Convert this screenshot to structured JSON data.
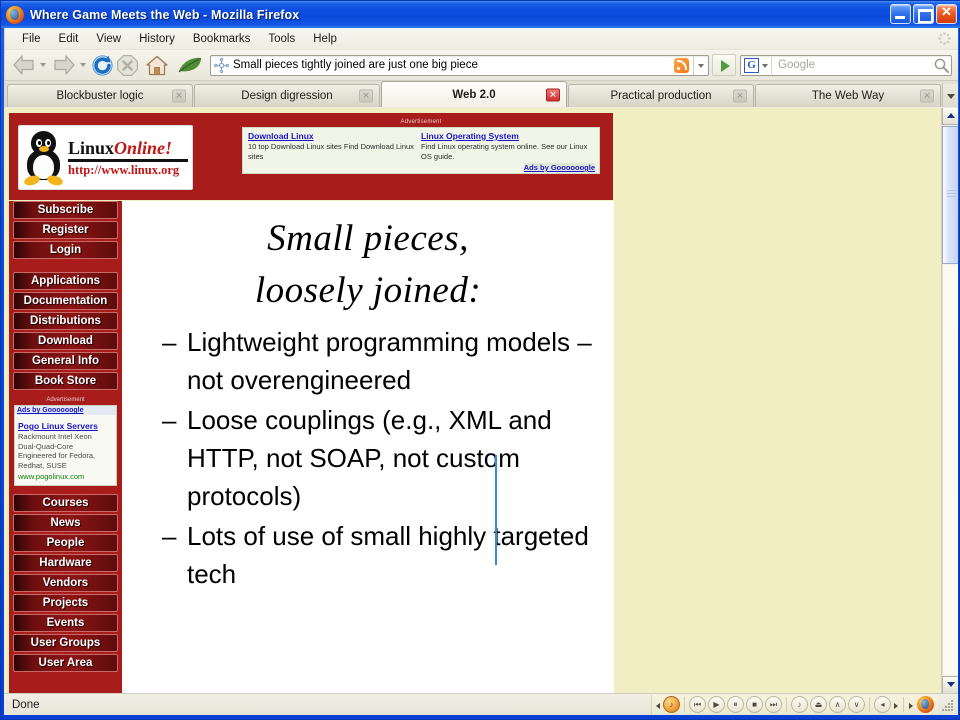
{
  "window": {
    "title": "Where Game Meets the Web - Mozilla Firefox",
    "minimize_label": "Minimize",
    "maximize_label": "Maximize",
    "close_label": "Close"
  },
  "menu": {
    "items": [
      "File",
      "Edit",
      "View",
      "History",
      "Bookmarks",
      "Tools",
      "Help"
    ]
  },
  "toolbar": {
    "back_label": "Back",
    "forward_label": "Forward",
    "reload_label": "Reload",
    "stop_label": "Stop",
    "home_label": "Home",
    "leaf_label": "Feather",
    "url": "Small pieces tightly joined are just one big piece",
    "go_label": "Go",
    "search_engine": "G",
    "search_placeholder": "Google",
    "search_value": ""
  },
  "tabs": [
    {
      "label": "Blockbuster logic",
      "active": false
    },
    {
      "label": "Design digression",
      "active": false
    },
    {
      "label": "Web 2.0",
      "active": true
    },
    {
      "label": "Practical production",
      "active": false
    },
    {
      "label": "The Web Way",
      "active": false
    }
  ],
  "site": {
    "logo": {
      "word_linux": "Linux",
      "word_online": "Online!",
      "url": "http://www.linux.org"
    },
    "banner_color": "#a81c1c",
    "page_background": "#f2eec4",
    "top_ad": {
      "advertisement_label": "Advertisement",
      "columns": [
        {
          "title": "Download Linux",
          "body": "10 top Download Linux sites Find Download Linux sites"
        },
        {
          "title": "Linux Operating System",
          "body": "Find Linux operating system online. See our Linux OS guide."
        }
      ],
      "ads_by": "Ads by Goooooogle"
    },
    "nav_group_1": [
      "Subscribe",
      "Register",
      "Login"
    ],
    "nav_group_2": [
      "Applications",
      "Documentation",
      "Distributions",
      "Download",
      "General Info",
      "Book Store"
    ],
    "side_ad": {
      "advertisement_label": "Advertisement",
      "ads_by": "Ads by Goooooogle",
      "title": "Pogo Linux Servers",
      "body_lines": [
        "Rackmount Intel Xeon",
        "Dual-Quad-Core",
        "Engineered for Fedora,",
        "Redhat, SUSE"
      ],
      "url": "www.pogolinux.com"
    },
    "nav_group_3": [
      "Courses",
      "News",
      "People",
      "Hardware",
      "Vendors",
      "Projects",
      "Events",
      "User Groups",
      "User Area"
    ]
  },
  "slide": {
    "title_line_1": "Small pieces,",
    "title_line_2": "loosely joined:",
    "bullet_dash": "–",
    "bullets": [
      "Lightweight programming models – not overengineered",
      "Loose couplings (e.g., XML and HTTP, not SOAP, not custom protocols)",
      "Lots of use of small highly targeted tech"
    ]
  },
  "status": {
    "text": "Done",
    "media_tray": {
      "prev_track": "⏮",
      "play": "▶",
      "pause": "⏸",
      "stop": "■",
      "next_track": "⏭",
      "music": "♪",
      "eject": "⏏",
      "volume_up": "∧",
      "volume_down": "∨",
      "mute": "◂",
      "more": "▸"
    }
  }
}
